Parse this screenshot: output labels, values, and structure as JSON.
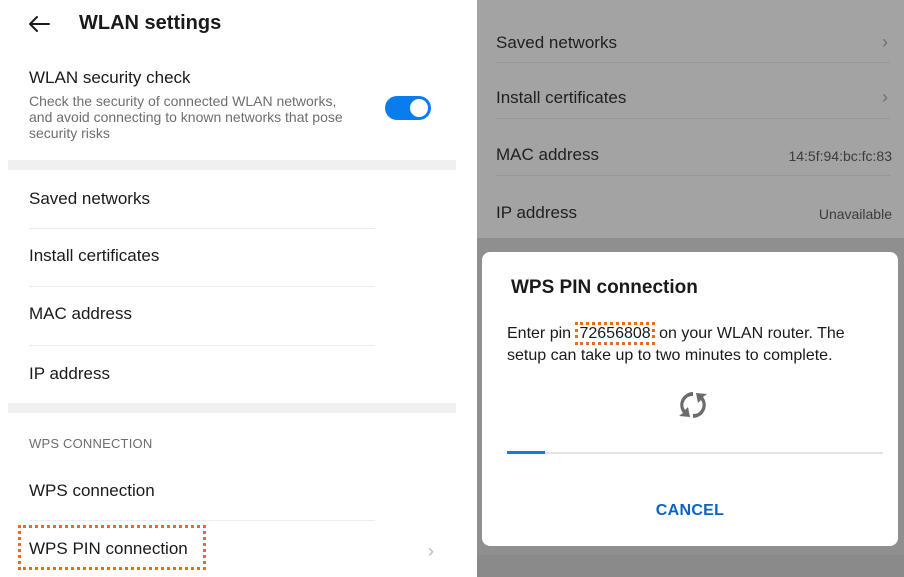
{
  "left_panel": {
    "header": {
      "title": "WLAN settings",
      "back_icon": "back-arrow-icon"
    },
    "security_check": {
      "title": "WLAN security check",
      "description": "Check the security of connected WLAN networks, and avoid connecting to known networks that pose security risks",
      "enabled": true
    },
    "items": [
      {
        "label": "Saved networks"
      },
      {
        "label": "Install certificates"
      },
      {
        "label": "MAC address"
      },
      {
        "label": "IP address"
      }
    ],
    "wps_section": {
      "header": "WPS CONNECTION",
      "items": [
        {
          "label": "WPS connection"
        },
        {
          "label": "WPS PIN connection"
        }
      ]
    }
  },
  "right_panel": {
    "items": [
      {
        "label": "Saved networks",
        "value": ""
      },
      {
        "label": "Install certificates",
        "value": ""
      },
      {
        "label": "MAC address",
        "value": "14:5f:94:bc:fc:83"
      },
      {
        "label": "IP address",
        "value": "Unavailable"
      }
    ],
    "dialog": {
      "title": "WPS PIN connection",
      "message_before": "Enter pin ",
      "pin": "72656808",
      "message_after": " on your WLAN router. The setup can take up to two minutes to complete.",
      "icon": "wps-icon",
      "progress": 0.1,
      "cancel_label": "CANCEL"
    }
  },
  "colors": {
    "accent": "#0a7dee",
    "highlight": "#ea6b1b",
    "dim_overlay": "#a3a3a3"
  }
}
